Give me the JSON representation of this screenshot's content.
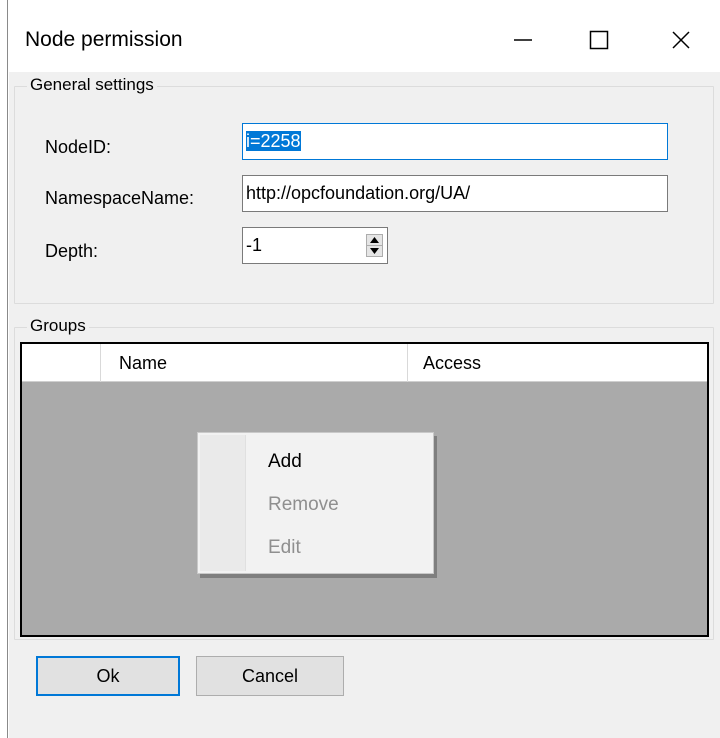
{
  "window": {
    "title": "Node permission"
  },
  "general": {
    "legend": "General settings",
    "nodeid_label": "NodeID:",
    "nodeid_prefix": "i",
    "nodeid_rest": "=2258",
    "namespace_label": "NamespaceName:",
    "namespace_value": "http://opcfoundation.org/UA/",
    "depth_label": "Depth:",
    "depth_value": "-1"
  },
  "groups": {
    "legend": "Groups",
    "columns": [
      "Name",
      "Access"
    ]
  },
  "context_menu": {
    "items": [
      {
        "label": "Add",
        "enabled": true
      },
      {
        "label": "Remove",
        "enabled": false
      },
      {
        "label": "Edit",
        "enabled": false
      }
    ]
  },
  "buttons": {
    "ok": "Ok",
    "cancel": "Cancel"
  },
  "icons": {
    "minimize": "minimize-icon",
    "maximize": "maximize-icon",
    "close": "close-icon",
    "spin_up": "arrow-up-icon",
    "spin_down": "arrow-down-icon"
  },
  "colors": {
    "accent": "#0078d7",
    "grid_background": "#aaaaaa",
    "dialog_background": "#f0f0f0"
  }
}
